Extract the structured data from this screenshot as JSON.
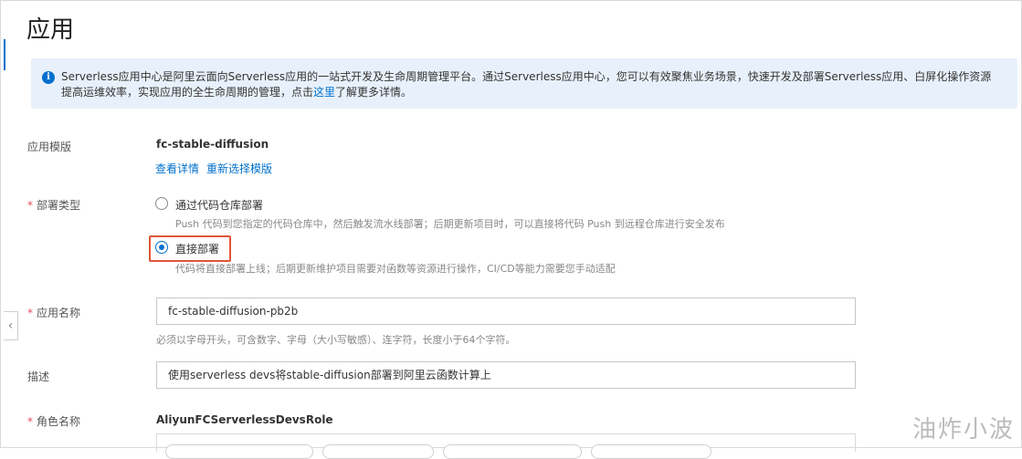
{
  "page": {
    "title": "应用"
  },
  "notice": {
    "text_before": "Serverless应用中心是阿里云面向Serverless应用的一站式开发及生命周期管理平台。通过Serverless应用中心，您可以有效聚焦业务场景，快速开发及部署Serverless应用、白屏化操作资源提高运维效率，实现应用的全生命周期的管理，点击",
    "link": "这里",
    "text_after": "了解更多详情。"
  },
  "template": {
    "label": "应用模版",
    "value": "fc-stable-diffusion",
    "view_details": "查看详情",
    "reselect": "重新选择模版"
  },
  "deploy_type": {
    "required_mark": "*",
    "label": "部署类型",
    "options": [
      {
        "label": "通过代码仓库部署",
        "hint": "Push 代码到您指定的代码仓库中，然后触发流水线部署；后期更新项目时，可以直接将代码 Push 到远程仓库进行安全发布",
        "checked": false
      },
      {
        "label": "直接部署",
        "hint": "代码将直接部署上线；后期更新维护项目需要对函数等资源进行操作，CI/CD等能力需要您手动适配",
        "checked": true
      }
    ]
  },
  "app_name": {
    "required_mark": "*",
    "label": "应用名称",
    "value": "fc-stable-diffusion-pb2b",
    "hint": "必须以字母开头，可含数字、字母（大小写敏感）、连字符，长度小于64个字符。"
  },
  "description": {
    "label": "描述",
    "value": "使用serverless devs将stable-diffusion部署到阿里云函数计算上"
  },
  "role": {
    "required_mark": "*",
    "label": "角色名称",
    "value": "AliyunFCServerlessDevsRole"
  },
  "sidebar_toggle": {
    "icon": "chevron-left-icon",
    "glyph": "‹"
  },
  "watermark": "油炸小波",
  "colors": {
    "accent": "#0070cc",
    "notice_bg": "#e8f1fb",
    "highlight": "#e0563a",
    "required": "#e34d59"
  }
}
